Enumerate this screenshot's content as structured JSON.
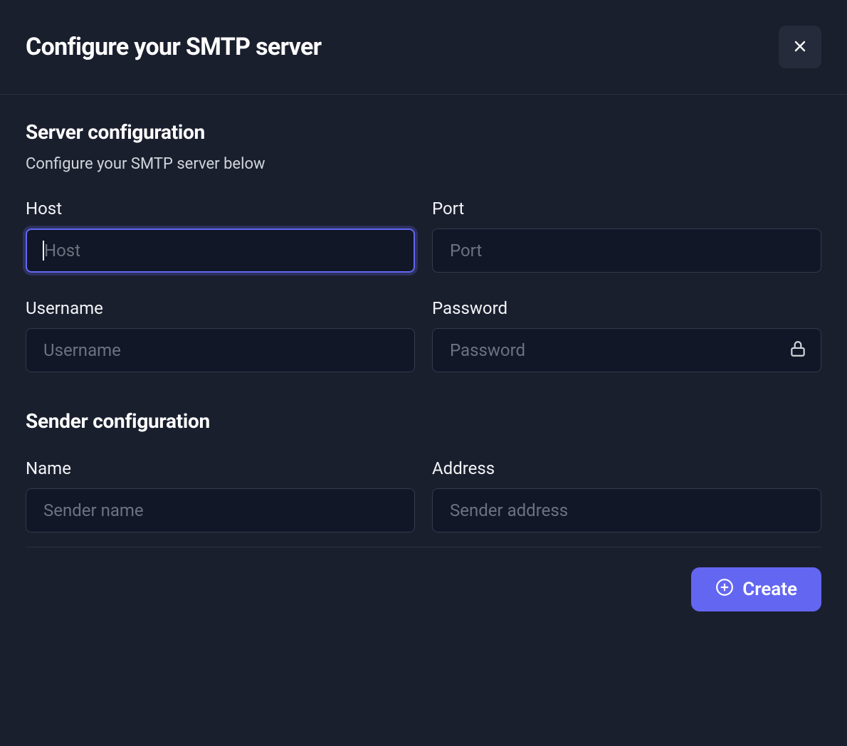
{
  "modal": {
    "title": "Configure your SMTP server"
  },
  "server": {
    "title": "Server configuration",
    "subtitle": "Configure your SMTP server below",
    "host": {
      "label": "Host",
      "placeholder": "Host",
      "value": ""
    },
    "port": {
      "label": "Port",
      "placeholder": "Port",
      "value": ""
    },
    "username": {
      "label": "Username",
      "placeholder": "Username",
      "value": ""
    },
    "password": {
      "label": "Password",
      "placeholder": "Password",
      "value": ""
    }
  },
  "sender": {
    "title": "Sender configuration",
    "name": {
      "label": "Name",
      "placeholder": "Sender name",
      "value": ""
    },
    "address": {
      "label": "Address",
      "placeholder": "Sender address",
      "value": ""
    }
  },
  "actions": {
    "create_label": "Create"
  },
  "icons": {
    "close": "close-icon",
    "lock": "lock-icon",
    "plus_circle": "plus-circle-icon"
  }
}
